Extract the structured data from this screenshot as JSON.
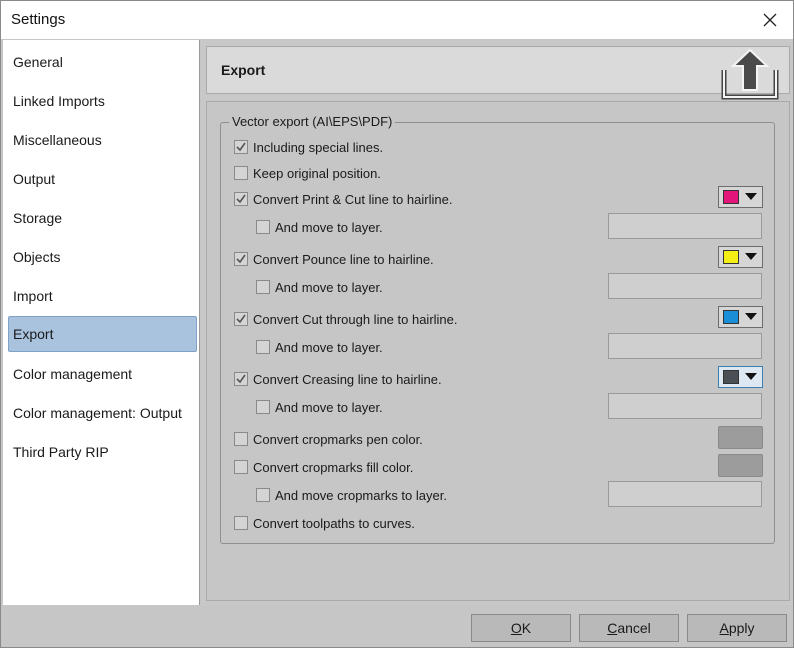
{
  "window": {
    "title": "Settings"
  },
  "sidebar": {
    "items": [
      {
        "label": "General"
      },
      {
        "label": "Linked Imports"
      },
      {
        "label": "Miscellaneous"
      },
      {
        "label": "Output"
      },
      {
        "label": "Storage"
      },
      {
        "label": "Objects"
      },
      {
        "label": "Import"
      },
      {
        "label": "Export",
        "selected": true
      },
      {
        "label": "Color management"
      },
      {
        "label": "Color management: Output"
      },
      {
        "label": "Third Party RIP"
      }
    ]
  },
  "panel": {
    "title": "Export",
    "icon": "export-upload-icon"
  },
  "group": {
    "legend": "Vector export (AI\\EPS\\PDF)",
    "options": {
      "special_lines": {
        "label": "Including special lines.",
        "checked": true
      },
      "keep_position": {
        "label": "Keep original position.",
        "checked": false
      },
      "print_cut": {
        "label": "Convert Print & Cut line to hairline.",
        "checked": true,
        "color": "#e3157a"
      },
      "print_cut_move": {
        "label": "And move to layer.",
        "checked": false,
        "layer": ""
      },
      "pounce": {
        "label": "Convert Pounce line to hairline.",
        "checked": true,
        "color": "#f5ef15"
      },
      "pounce_move": {
        "label": "And move to layer.",
        "checked": false,
        "layer": ""
      },
      "cut_through": {
        "label": "Convert Cut through line to hairline.",
        "checked": true,
        "color": "#1a8fd8"
      },
      "cut_through_move": {
        "label": "And move to layer.",
        "checked": false,
        "layer": ""
      },
      "creasing": {
        "label": "Convert Creasing line to hairline.",
        "checked": true,
        "color": "#4a4f55"
      },
      "creasing_move": {
        "label": "And move to layer.",
        "checked": false,
        "layer": ""
      },
      "cropmarks_pen": {
        "label": "Convert cropmarks pen color.",
        "checked": false,
        "color": "#9c9c9c"
      },
      "cropmarks_fill": {
        "label": "Convert cropmarks fill color.",
        "checked": false,
        "color": "#9c9c9c"
      },
      "cropmarks_move": {
        "label": "And move cropmarks to layer.",
        "checked": false,
        "layer": ""
      },
      "toolpaths": {
        "label": "Convert toolpaths to curves.",
        "checked": false
      }
    }
  },
  "footer": {
    "ok": {
      "mnemonic": "O",
      "rest": "K"
    },
    "cancel": {
      "mnemonic": "C",
      "rest": "ancel"
    },
    "apply": {
      "mnemonic": "A",
      "rest": "pply"
    }
  }
}
